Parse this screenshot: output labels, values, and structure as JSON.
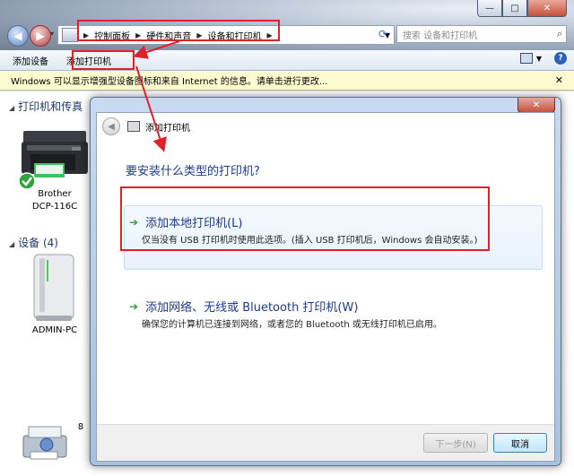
{
  "window": {
    "minimize": "—",
    "maximize": "□",
    "close": "✕"
  },
  "address": {
    "crumbs": [
      "控制面板",
      "硬件和声音",
      "设备和打印机"
    ],
    "search_placeholder": "搜索 设备和打印机"
  },
  "toolbar": {
    "add_device": "添加设备",
    "add_printer": "添加打印机"
  },
  "infobar": {
    "text": "Windows 可以显示增强型设备图标和来自 Internet 的信息。请单击进行更改..."
  },
  "groups": {
    "printers_label": "打印机和传真",
    "devices_label": "设备 (4)"
  },
  "devices": {
    "printer_name": "Brother",
    "printer_model": "DCP-116C",
    "pc_name": "ADMIN-PC",
    "bottom_count": "8"
  },
  "dialog": {
    "title": "添加打印机",
    "question": "要安装什么类型的打印机?",
    "options": [
      {
        "title": "添加本地打印机(L)",
        "desc": "仅当没有 USB 打印机时使用此选项。(插入 USB 打印机后，Windows 会自动安装。)"
      },
      {
        "title": "添加网络、无线或 Bluetooth 打印机(W)",
        "desc": "确保您的计算机已连接到网络，或者您的 Bluetooth 或无线打印机已启用。"
      }
    ],
    "next_button": "下一步(N)",
    "cancel_button": "取消",
    "close": "✕"
  },
  "colors": {
    "highlight": "#e0202a",
    "link_blue": "#1e3a8e"
  }
}
